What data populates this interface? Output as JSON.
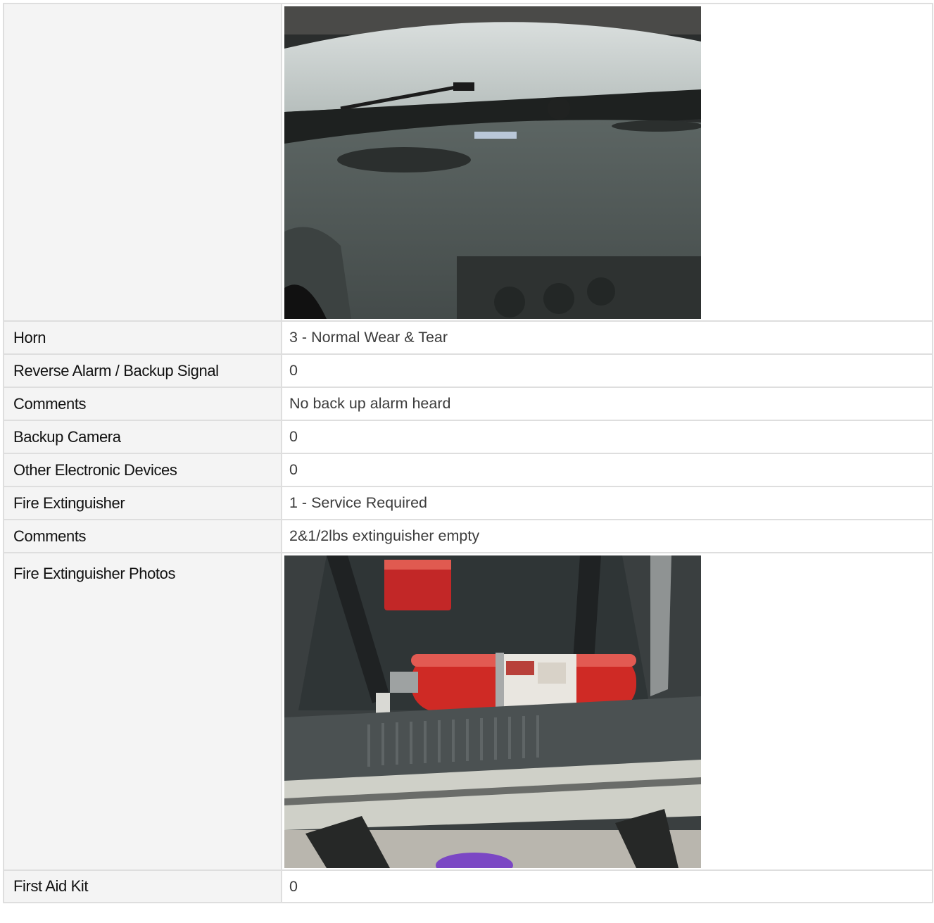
{
  "rows": [
    {
      "label": "",
      "photo": "dashboard-photo"
    },
    {
      "label": "Horn",
      "value": "3 - Normal Wear & Tear"
    },
    {
      "label": "Reverse Alarm / Backup Signal",
      "value": "0"
    },
    {
      "label": "Comments",
      "value": "No back up alarm heard"
    },
    {
      "label": "Backup Camera",
      "value": "0"
    },
    {
      "label": "Other Electronic Devices",
      "value": "0"
    },
    {
      "label": "Fire Extinguisher",
      "value": "1 - Service Required"
    },
    {
      "label": "Comments",
      "value": "2&1/2lbs extinguisher empty"
    },
    {
      "label": "Fire Extinguisher Photos",
      "photo": "fire-extinguisher-photo"
    },
    {
      "label": "First Aid Kit",
      "value": "0"
    }
  ]
}
